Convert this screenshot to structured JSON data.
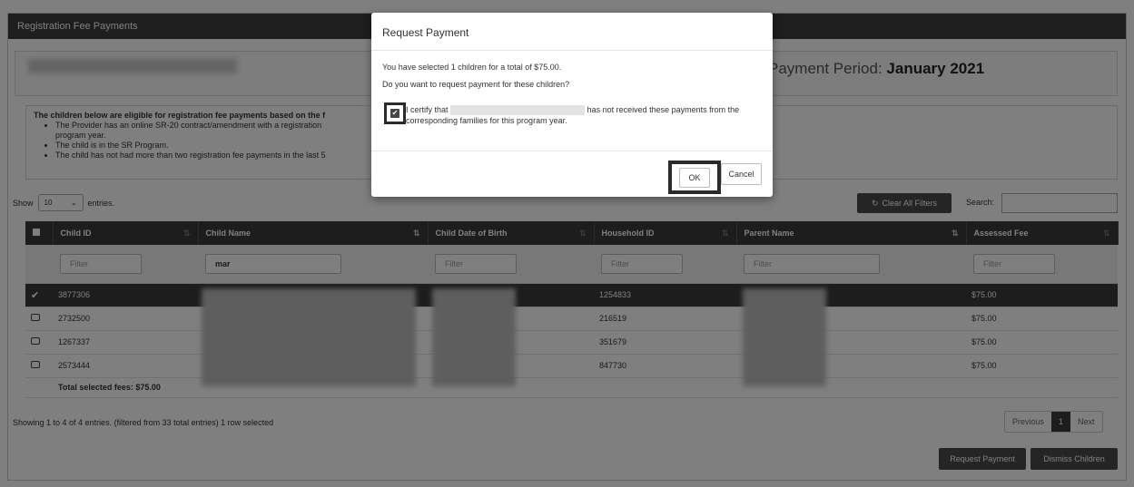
{
  "panel": {
    "title": "Registration Fee Payments"
  },
  "payment_period": {
    "label": "Payment Period:",
    "value": "January 2021"
  },
  "eligibility": {
    "lead": "The children below are eligible for registration fee payments based on the f",
    "bullets": [
      "The Provider has an online SR-20 contract/amendment with a registration",
      "program year.",
      "The child is in the SR Program.",
      "The child has not had more than two registration fee payments in the last 5"
    ]
  },
  "length_control": {
    "show": "Show",
    "value": "10",
    "entries": "entries."
  },
  "toolbar": {
    "clear_filters": "Clear All Filters",
    "search_label": "Search:"
  },
  "table": {
    "headers": [
      "Child ID",
      "Child Name",
      "Child Date of Birth",
      "Household ID",
      "Parent Name",
      "Assessed Fee"
    ],
    "filters": [
      "Filter",
      "mar",
      "Filter",
      "Filter",
      "Filter",
      "Filter"
    ],
    "rows": [
      {
        "child_id": "3877306",
        "household_id": "1254833",
        "fee": "$75.00",
        "selected": true
      },
      {
        "child_id": "2732500",
        "household_id": "216519",
        "fee": "$75.00",
        "selected": false
      },
      {
        "child_id": "1267337",
        "household_id": "351679",
        "fee": "$75.00",
        "selected": false
      },
      {
        "child_id": "2573444",
        "household_id": "847730",
        "fee": "$75.00",
        "selected": false
      }
    ],
    "total": "Total selected fees: $75.00"
  },
  "footer": {
    "info": "Showing 1 to 4 of 4 entries. (filtered from 33 total entries)   1 row selected",
    "pager": {
      "previous": "Previous",
      "current": "1",
      "next": "Next"
    },
    "request_payment": "Request Payment",
    "dismiss_children": "Dismiss Children"
  },
  "modal": {
    "title": "Request Payment",
    "line1": "You have selected 1 children for a total of $75.00.",
    "line2": "Do you want to request payment for these children?",
    "certify_prefix": "I certify that",
    "certify_suffix": "has not received these payments from the",
    "certify_line2": "corresponding families for this program year.",
    "ok": "OK",
    "cancel": "Cancel"
  }
}
